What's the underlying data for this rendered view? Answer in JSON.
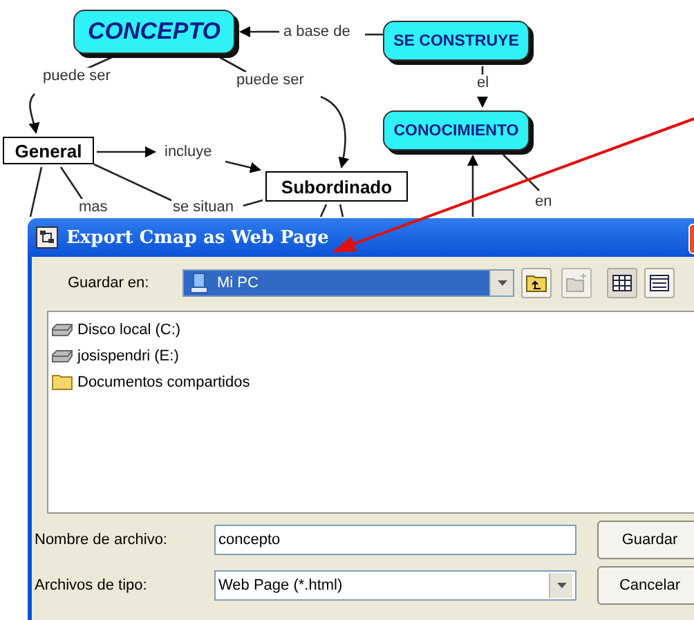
{
  "concept_map": {
    "nodes": [
      {
        "label": "CONCEPTO",
        "kind": "concept"
      },
      {
        "label": "SE CONSTRUYE",
        "kind": "concept"
      },
      {
        "label": "CONOCIMIENTO",
        "kind": "concept"
      },
      {
        "label": "General",
        "kind": "plain"
      },
      {
        "label": "Subordinado",
        "kind": "plain"
      }
    ],
    "links": [
      "a base de",
      "puede ser",
      "puede ser",
      "el",
      "incluye",
      "en",
      "mas",
      "se situan"
    ]
  },
  "dialog": {
    "title": "Export Cmap as Web Page",
    "save_in": {
      "label": "Guardar en:",
      "value": "Mi PC"
    },
    "items": [
      {
        "label": "Disco local (C:)",
        "kind": "drive"
      },
      {
        "label": "josispendri (E:)",
        "kind": "drive"
      },
      {
        "label": "Documentos compartidos",
        "kind": "folder"
      }
    ],
    "file_name": {
      "label": "Nombre de archivo:",
      "value": "concepto"
    },
    "file_type": {
      "label": "Archivos de tipo:",
      "value": "Web Page (*.html)"
    },
    "buttons": [
      "Guardar",
      "Cancelar"
    ]
  }
}
